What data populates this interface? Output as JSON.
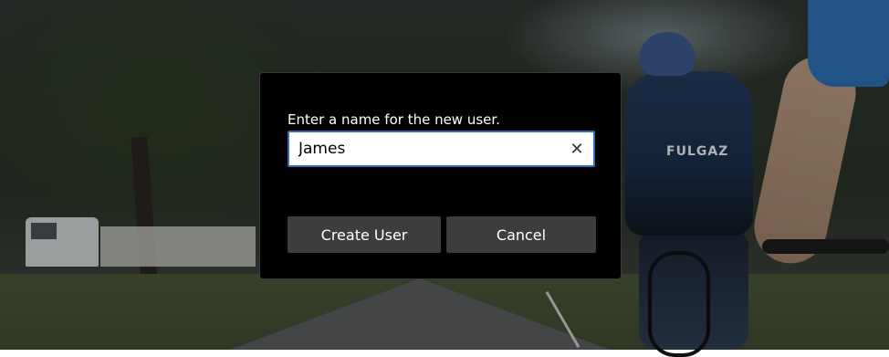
{
  "dialog": {
    "prompt": "Enter a name for the new user.",
    "name_value": "James",
    "clear_icon": "close-icon",
    "create_label": "Create User",
    "cancel_label": "Cancel"
  },
  "background": {
    "jersey_text": "FULGAZ"
  },
  "colors": {
    "dialog_bg": "#010101",
    "input_border_focus": "#2b6fb6",
    "button_bg": "#3d3d3d",
    "text": "#ffffff"
  }
}
